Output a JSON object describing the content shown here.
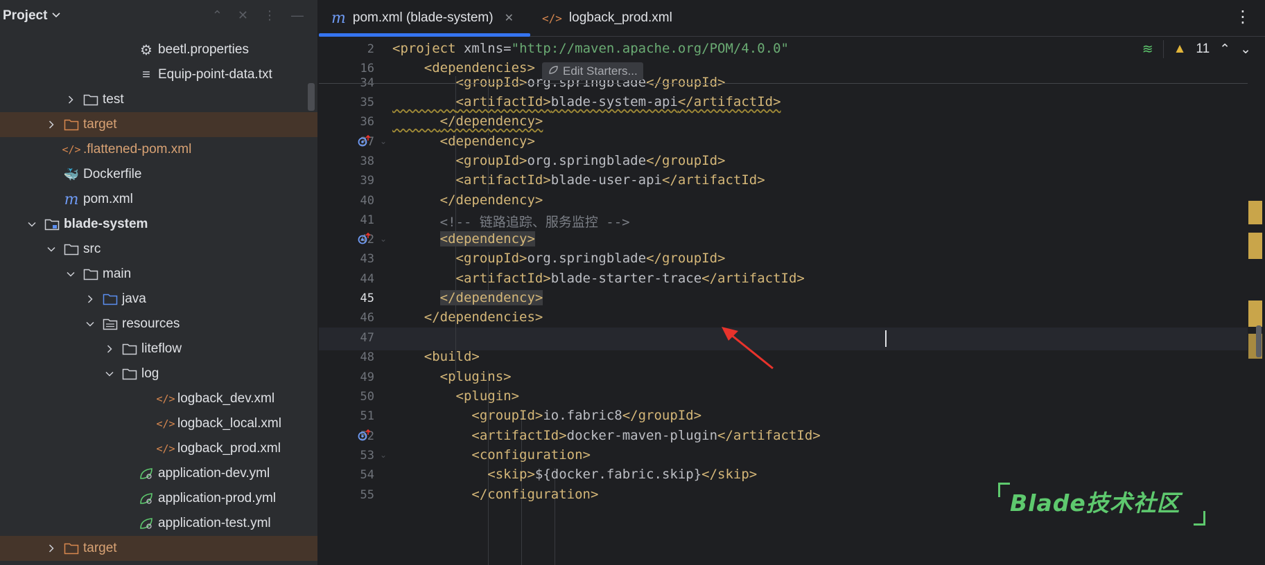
{
  "project_panel": {
    "title": "Project",
    "items": [
      {
        "label": "beetl.properties",
        "type": "gear-file"
      },
      {
        "label": "Equip-point-data.txt",
        "type": "text-file"
      },
      {
        "label": "test",
        "type": "folder"
      },
      {
        "label": "target",
        "type": "folder-orange"
      },
      {
        "label": ".flattened-pom.xml",
        "type": "xml-file"
      },
      {
        "label": "Dockerfile",
        "type": "docker-file"
      },
      {
        "label": "pom.xml",
        "type": "maven-file"
      },
      {
        "label": "blade-system",
        "type": "module"
      },
      {
        "label": "src",
        "type": "folder"
      },
      {
        "label": "main",
        "type": "folder"
      },
      {
        "label": "java",
        "type": "folder-blue"
      },
      {
        "label": "resources",
        "type": "resources-folder"
      },
      {
        "label": "liteflow",
        "type": "folder"
      },
      {
        "label": "log",
        "type": "folder"
      },
      {
        "label": "logback_dev.xml",
        "type": "xml-file"
      },
      {
        "label": "logback_local.xml",
        "type": "xml-file"
      },
      {
        "label": "logback_prod.xml",
        "type": "xml-file"
      },
      {
        "label": "application-dev.yml",
        "type": "spring-file"
      },
      {
        "label": "application-prod.yml",
        "type": "spring-file"
      },
      {
        "label": "application-test.yml",
        "type": "spring-file"
      },
      {
        "label": "target",
        "type": "folder-orange"
      }
    ]
  },
  "tabs": [
    {
      "label": "pom.xml (blade-system)",
      "active": true,
      "icon": "maven-icon"
    },
    {
      "label": "logback_prod.xml",
      "active": false,
      "icon": "xml-icon"
    }
  ],
  "inspections": {
    "warning_count": "11"
  },
  "edit_starters_label": "Edit Starters...",
  "code_lines": [
    {
      "n": "2",
      "html": "<span class=\"tag\">&lt;project</span> <span class=\"attr\">xmlns</span><span class=\"txt\">=</span><span class=\"str\">\"http://maven.apache.org/POM/4.0.0\"</span>"
    },
    {
      "n": "16",
      "html": "    <span class=\"tag\">&lt;dependencies&gt;</span>"
    },
    {
      "n": "34",
      "html": "        <span class=\"tag\">&lt;groupId&gt;</span>org.springblade<span class=\"tag\">&lt;/groupId&gt;</span>"
    },
    {
      "n": "35",
      "html": "<span class=\"wavy\">        <span class=\"tag\">&lt;artifactId&gt;</span>blade-system-api<span class=\"tag\">&lt;/artifactId&gt;</span></span>"
    },
    {
      "n": "36",
      "html": "<span class=\"wavy\">      <span class=\"tag\">&lt;/dependency&gt;</span></span>"
    },
    {
      "n": "37",
      "html": "      <span class=\"tag\">&lt;dependency&gt;</span>"
    },
    {
      "n": "38",
      "html": "        <span class=\"tag\">&lt;groupId&gt;</span>org.springblade<span class=\"tag\">&lt;/groupId&gt;</span>"
    },
    {
      "n": "39",
      "html": "        <span class=\"tag\">&lt;artifactId&gt;</span>blade-user-api<span class=\"tag\">&lt;/artifactId&gt;</span>"
    },
    {
      "n": "40",
      "html": "      <span class=\"tag\">&lt;/dependency&gt;</span>"
    },
    {
      "n": "41",
      "html": "      <span class=\"cmt\">&lt;!-- 链路追踪、服务监控 --&gt;</span>"
    },
    {
      "n": "42",
      "html": "      <span class=\"tag tagbg\">&lt;dependency&gt;</span>"
    },
    {
      "n": "43",
      "html": "        <span class=\"tag\">&lt;groupId&gt;</span>org.springblade<span class=\"tag\">&lt;/groupId&gt;</span>"
    },
    {
      "n": "44",
      "html": "        <span class=\"tag\">&lt;artifactId&gt;</span>blade-starter-trace<span class=\"tag\">&lt;/artifactId&gt;</span>"
    },
    {
      "n": "45",
      "html": "      <span class=\"tag tagbg\">&lt;/dependency&gt;</span>"
    },
    {
      "n": "46",
      "html": "    <span class=\"tag\">&lt;/dependencies&gt;</span>"
    },
    {
      "n": "47",
      "html": ""
    },
    {
      "n": "48",
      "html": "    <span class=\"tag\">&lt;build&gt;</span>"
    },
    {
      "n": "49",
      "html": "      <span class=\"tag\">&lt;plugins&gt;</span>"
    },
    {
      "n": "50",
      "html": "        <span class=\"tag\">&lt;plugin&gt;</span>"
    },
    {
      "n": "51",
      "html": "          <span class=\"tag\">&lt;groupId&gt;</span>io.fabric8<span class=\"tag\">&lt;/groupId&gt;</span>"
    },
    {
      "n": "52",
      "html": "          <span class=\"tag\">&lt;artifactId&gt;</span>docker-maven-plugin<span class=\"tag\">&lt;/artifactId&gt;</span>"
    },
    {
      "n": "53",
      "html": "          <span class=\"tag\">&lt;configuration&gt;</span>"
    },
    {
      "n": "54",
      "html": "            <span class=\"tag\">&lt;skip&gt;</span>${docker.fabric.skip}<span class=\"tag\">&lt;/skip&gt;</span>"
    },
    {
      "n": "55",
      "html": "          <span class=\"tag\">&lt;/configuration&gt;</span>"
    }
  ],
  "watermark": "Blade技术社区",
  "colors": {
    "accent": "#3574f0",
    "tag": "#d5b778",
    "string": "#6aab73",
    "warning": "#c9a54a"
  }
}
